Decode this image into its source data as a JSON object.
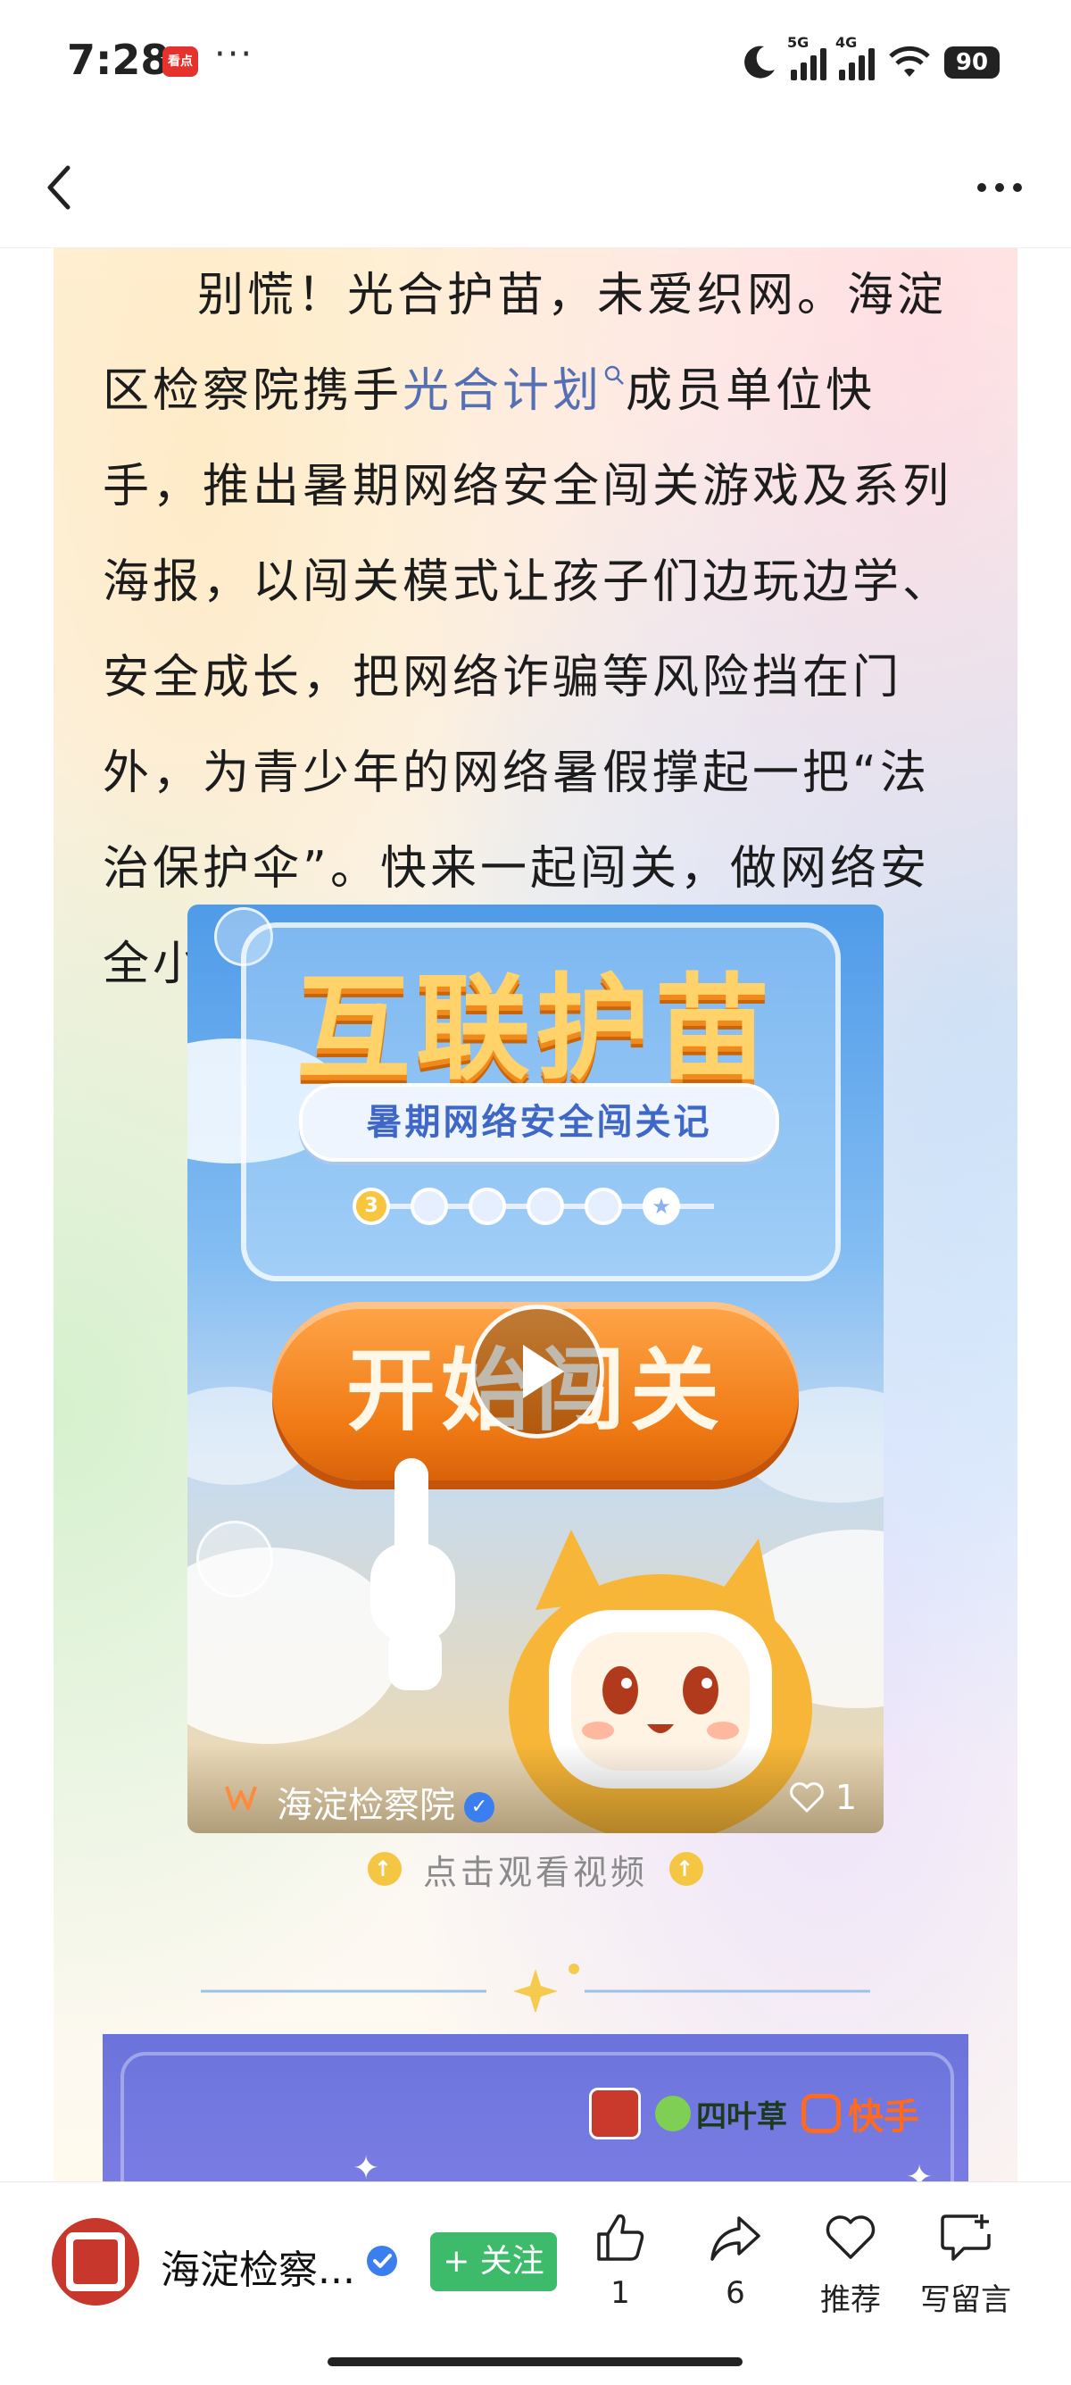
{
  "status_bar": {
    "time": "7:28",
    "app_icon": "看点",
    "dots": "···",
    "network_5g": "5G",
    "network_4g": "4G",
    "battery": "90"
  },
  "nav": {
    "back_icon": "chevron-left-icon",
    "more_icon": "more-horizontal-icon"
  },
  "article": {
    "paragraph_before_link": "别慌！光合护苗，未爱织网。海淀区检察院携手",
    "link_text": "光合计划",
    "paragraph_after_link": "成员单位快手，推出暑期网络安全闯关游戏及系列海报，以闯关模式让孩子们边玩边学、安全成长，把网络诈骗等风险挡在门外，为青少年的网络暑假撑起一把“法治保护伞”。快来一起闯关，做网络安全小达人！"
  },
  "video": {
    "poster_title": "互联护苗",
    "poster_subtitle": "暑期网络安全闯关记",
    "progress_step": "3",
    "start_button_text": "开始闯关",
    "author": "海淀检察院",
    "likes": "1"
  },
  "watch_hint": "点击观看视频",
  "poster2": {
    "logo_text_1": "四叶草",
    "logo_text_2": "快手"
  },
  "bottom_bar": {
    "account_name": "海淀检察...",
    "follow_label": "+ 关注",
    "like_count": "1",
    "share_count": "6",
    "recommend_label": "推荐",
    "comment_label": "写留言"
  },
  "colors": {
    "link": "#556fb4",
    "follow_button": "#3dba6a",
    "verified": "#3b7ef0",
    "orange": "#f07a14"
  }
}
